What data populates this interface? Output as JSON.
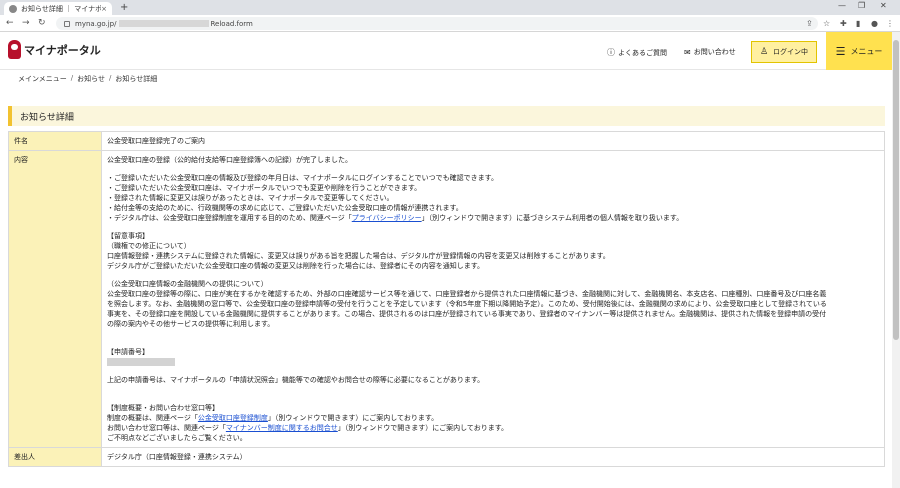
{
  "browser": {
    "tab_title": "お知らせ詳細 ｜ マイナポータル",
    "tab_close": "×",
    "new_tab": "+",
    "minimize": "—",
    "maximize": "❐",
    "close": "✕",
    "url_host": "myna.go.jp/",
    "url_path": "Reload.form"
  },
  "header": {
    "logo_text": "マイナポータル",
    "faq_label": "よくあるご質問",
    "contact_label": "お問い合わせ",
    "login_label": "ログイン中",
    "menu_label": "メニュー"
  },
  "breadcrumb": [
    "メインメニュー",
    "お知らせ",
    "お知らせ詳細"
  ],
  "breadcrumb_sep": "/",
  "page_title": "お知らせ詳細",
  "detail": {
    "subject_label": "件名",
    "subject_value": "公金受取口座登録完了のご案内",
    "content_label": "内容",
    "sender_label": "差出人",
    "sender_value": "デジタル庁（口座情報登録・連携システム）",
    "body": {
      "intro": "公金受取口座の登録（公的給付支給等口座登録簿への記録）が完了しました。",
      "bullets": [
        "・ご登録いただいた公金受取口座の情報及び登録の年月日は、マイナポータルにログインすることでいつでも確認できます。",
        "・ご登録いただいた公金受取口座は、マイナポータルでいつでも変更や削除を行うことができます。",
        "・登録された情報に変更又は誤りがあったときは、マイナポータルで変更等してください。",
        "・給付金等の支給のために、行政機関等の求めに応じて、ご登録いただいた公金受取口座の情報が連携されます。"
      ],
      "privacy_prefix": "・デジタル庁は、公金受取口座登録制度を運用する目的のため、関連ページ「",
      "privacy_link": "プライバシーポリシー",
      "privacy_suffix": "」（別ウィンドウで開きます）に基づきシステム利用者の個人情報を取り扱います。",
      "notes_heading": "【留意事項】",
      "notes_sub": "（職権での修正について）",
      "notes_lines": [
        "口座情報登録・連携システムに登録された情報に、変更又は誤りがある旨を把握した場合は、デジタル庁が登録情報の内容を変更又は削除することがあります。",
        "デジタル庁がご登録いただいた公金受取口座の情報の変更又は削除を行った場合には、登録者にその内容を通知します。"
      ],
      "provision_heading": "（公金受取口座情報の金融機関への提供について）",
      "provision_lines": [
        "公金受取口座の登録等の際に、口座が実在するかを確認するため、外部の口座確認サービス等を通じて、口座登録者から提供された口座情報に基づき、金融機関に対して、金融機関名、本支店名、口座種別、口座番号及び口座名義",
        "を照会します。なお、金融機関の窓口等で、公金受取口座の登録申請等の受付を行うことを予定しています（令和5年度下期以降開始予定）。このため、受付開始後には、金融機関の求めにより、公金受取口座として登録されている",
        "事実を、その登録口座を開設している金融機関に提供することがあります。この場合、提供されるのは口座が登録されている事実であり、登録者のマイナンバー等は提供されません。金融機関は、提供された情報を登録申請の受付",
        "の際の案内やその他サービスの提供等に利用します。"
      ],
      "application_heading": "【申請番号】",
      "application_note": "上記の申請番号は、マイナポータルの「申請状況照会」機能等での確認やお問合せの際等に必要になることがあります。",
      "system_heading": "【制度概要・お問い合わせ窓口等】",
      "system_prefix": "制度の概要は、関連ページ「",
      "system_link": "公金受取口座登録制度",
      "system_suffix": "」（別ウィンドウで開きます）にご案内しております。",
      "contact_prefix": "お問い合わせ窓口等は、関連ページ「",
      "contact_link": "マイナンバー制度に関するお問合せ",
      "contact_suffix": "」（別ウィンドウで開きます）にご案内しております。",
      "closing": "ご不明点などございましたらご覧ください。"
    }
  }
}
